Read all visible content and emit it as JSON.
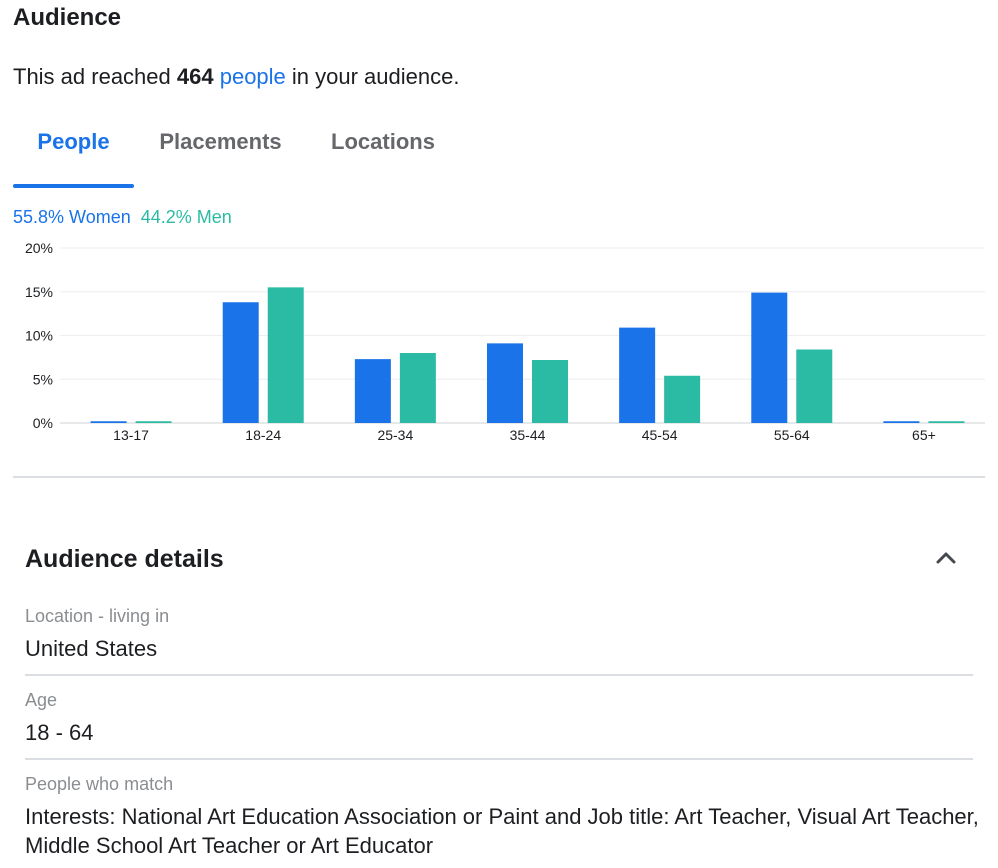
{
  "header": {
    "title": "Audience"
  },
  "reach": {
    "prefix": "This ad reached ",
    "count": "464",
    "link": "people",
    "suffix": " in your audience."
  },
  "tabs": [
    {
      "label": "People",
      "active": true
    },
    {
      "label": "Placements",
      "active": false
    },
    {
      "label": "Locations",
      "active": false
    }
  ],
  "gender": {
    "women": "55.8% Women",
    "men": "44.2% Men"
  },
  "colors": {
    "accent": "#1a73e8",
    "women": "#1a73e8",
    "men": "#2bbba4",
    "divider": "#dadde1",
    "muted": "#8a8d91"
  },
  "chart_data": {
    "type": "bar",
    "categories": [
      "13-17",
      "18-24",
      "25-34",
      "35-44",
      "45-54",
      "55-64",
      "65+"
    ],
    "series": [
      {
        "name": "Women",
        "color": "#1a73e8",
        "values": [
          0.2,
          13.8,
          7.3,
          9.1,
          10.9,
          14.9,
          0.2
        ]
      },
      {
        "name": "Men",
        "color": "#2bbba4",
        "values": [
          0.2,
          15.5,
          8.0,
          7.2,
          5.4,
          8.4,
          0.2
        ]
      }
    ],
    "y_ticks": [
      "0%",
      "5%",
      "10%",
      "15%",
      "20%"
    ],
    "ylim": [
      0,
      20
    ],
    "grid": true
  },
  "details": {
    "title": "Audience details",
    "location_label": "Location - living in",
    "location_value": "United States",
    "age_label": "Age",
    "age_value": "18 - 64",
    "match_label": "People who match",
    "match_value": "Interests: National Art Education Association or Paint and Job title: Art Teacher, Visual Art Teacher, Middle School Art Teacher or Art Educator"
  }
}
